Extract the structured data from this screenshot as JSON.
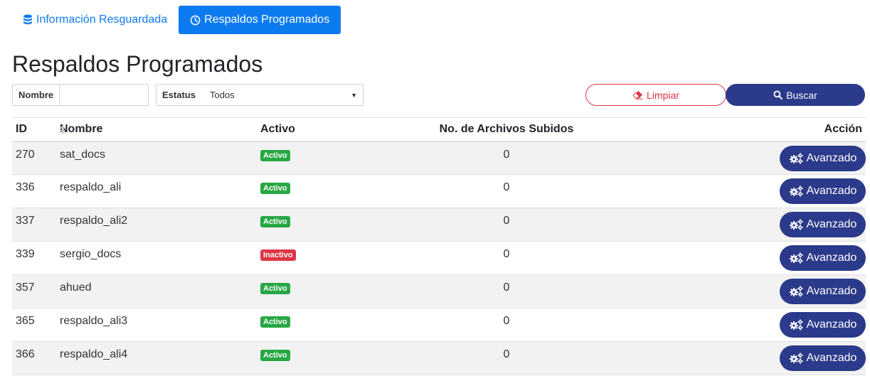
{
  "tabs": [
    {
      "label": "Información Resguardada",
      "icon": "database-icon",
      "active": false
    },
    {
      "label": "Respaldos Programados",
      "icon": "clock-icon",
      "active": true
    }
  ],
  "page_title": "Respaldos Programados",
  "filters": {
    "nombre_label": "Nombre",
    "nombre_value": "",
    "estatus_label": "Estatus",
    "estatus_value": "Todos"
  },
  "buttons": {
    "limpiar": "Limpiar",
    "buscar": "Buscar"
  },
  "table": {
    "headers": {
      "id": "ID",
      "nombre": "Nombre",
      "activo": "Activo",
      "archivos": "No. de Archivos Subidos",
      "accion": "Acción"
    },
    "rows": [
      {
        "id": "270",
        "nombre": "sat_docs",
        "estado": "Activo",
        "archivos": "0",
        "accion": "Avanzado"
      },
      {
        "id": "336",
        "nombre": "respaldo_ali",
        "estado": "Activo",
        "archivos": "0",
        "accion": "Avanzado"
      },
      {
        "id": "337",
        "nombre": "respaldo_ali2",
        "estado": "Activo",
        "archivos": "0",
        "accion": "Avanzado"
      },
      {
        "id": "339",
        "nombre": "sergio_docs",
        "estado": "Inactivo",
        "archivos": "0",
        "accion": "Avanzado"
      },
      {
        "id": "357",
        "nombre": "ahued",
        "estado": "Activo",
        "archivos": "0",
        "accion": "Avanzado"
      },
      {
        "id": "365",
        "nombre": "respaldo_ali3",
        "estado": "Activo",
        "archivos": "0",
        "accion": "Avanzado"
      },
      {
        "id": "366",
        "nombre": "respaldo_ali4",
        "estado": "Activo",
        "archivos": "0",
        "accion": "Avanzado"
      }
    ]
  },
  "colors": {
    "primary": "#0d7bf0",
    "navy": "#2b3a8a",
    "success": "#28a745",
    "danger": "#dc3545"
  }
}
